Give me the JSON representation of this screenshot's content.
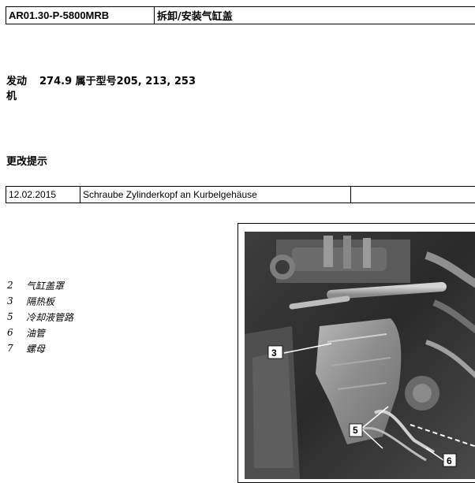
{
  "header": {
    "code": "AR01.30-P-5800MRB",
    "title": "拆卸/安装气缸盖"
  },
  "engine": {
    "label_line1": "发动",
    "label_line2": "机",
    "value": "274.9 属于型号205, 213, 253"
  },
  "change_notes": {
    "heading": "更改提示",
    "rows": [
      {
        "date": "12.02.2015",
        "description": "Schraube Zylinderkopf an Kurbelgehäuse",
        "extra": ""
      }
    ]
  },
  "legend": [
    {
      "num": "2",
      "text": "气缸盖罩"
    },
    {
      "num": "3",
      "text": "隔热板"
    },
    {
      "num": "5",
      "text": "冷却液管路"
    },
    {
      "num": "6",
      "text": "油管"
    },
    {
      "num": "7",
      "text": "螺母"
    }
  ],
  "figure": {
    "callouts": [
      "3",
      "5",
      "6"
    ]
  }
}
